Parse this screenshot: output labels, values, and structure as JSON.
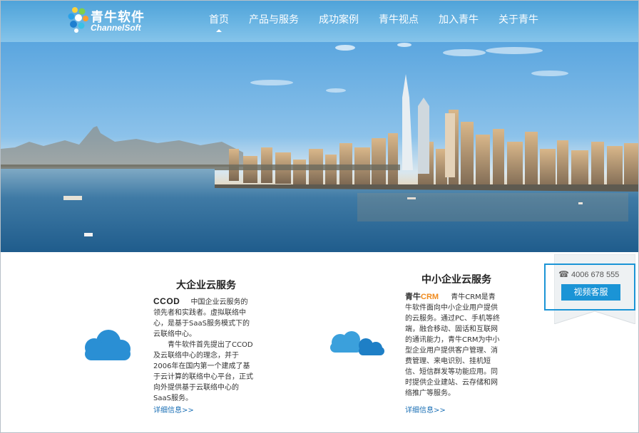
{
  "header": {
    "logo_cn": "青牛软件",
    "logo_en": "ChannelSoft",
    "nav": [
      "首页",
      "产品与服务",
      "成功案例",
      "青牛视点",
      "加入青牛",
      "关于青牛"
    ]
  },
  "large_enterprise": {
    "title": "大企业云服务",
    "brand": "CCOD",
    "intro": "中国企业云服务的领先者和实践者。虚拟联络中心，是基于SaaS服务模式下的云联络中心。",
    "lines": [
      "中国企业云服务的",
      "领先者和实践者。虚拟联络中",
      "心，是基于SaaS服务模式下的",
      "云联络中心。",
      "青牛软件首先提出了CCOD",
      "及云联络中心的理念，并于",
      "2006年在国内第一个建成了基",
      "于云计算的联络中心平台，正式",
      "向外提供基于云联络中心的",
      "SaaS服务。"
    ],
    "more": "详细信息>>"
  },
  "sme": {
    "title": "中小企业云服务",
    "brand_a": "青牛",
    "brand_b": "CRM",
    "lines": [
      "青牛CRM是青",
      "牛软件面向中小企业用户提供",
      "的云服务。通过PC、手机等终",
      "端，融合移动、固话和互联网",
      "的通讯能力，青牛CRM为中小",
      "型企业用户提供客户管理、消",
      "费管理、来电识别、挂机短",
      "信、短信群发等功能应用。同",
      "时提供企业建站、云存储和网",
      "络推广等服务。"
    ],
    "more": "详细信息>>"
  },
  "contact": {
    "phone": "4006 678 555",
    "button": "视频客服"
  },
  "colors": {
    "header": "#5aaade",
    "accent": "#1b94d6",
    "link": "#1a6fb5",
    "cloud": "#2a8fd4"
  }
}
